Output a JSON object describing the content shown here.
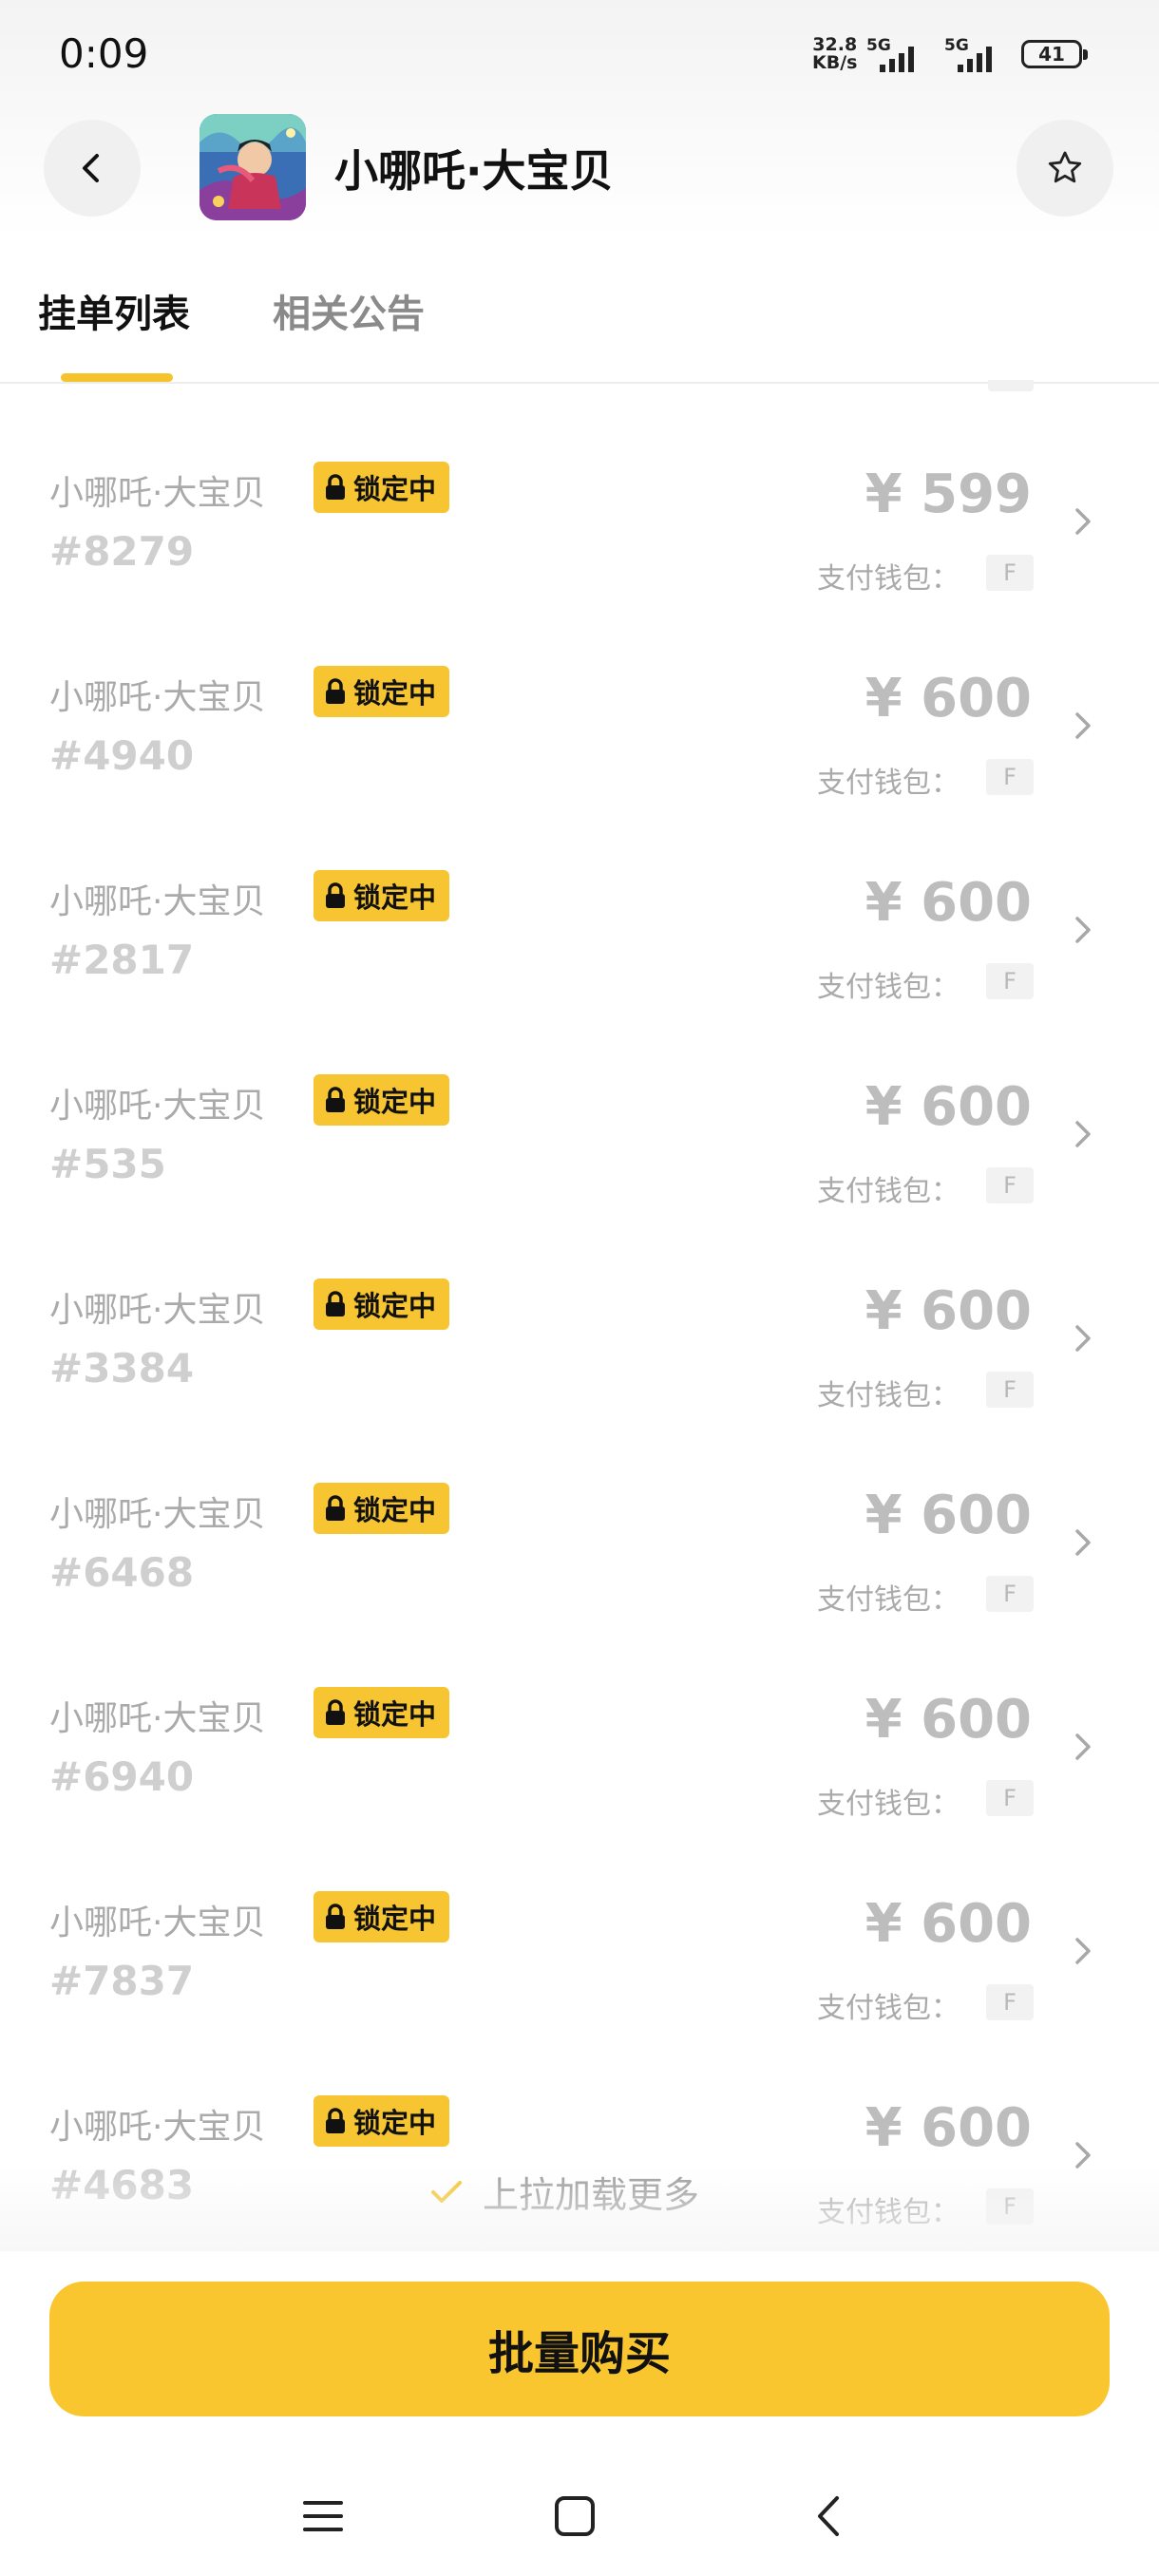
{
  "status_bar": {
    "time": "0:09",
    "net_speed_value": "32.8",
    "net_speed_unit": "KB/s",
    "signal_1_label": "5G",
    "signal_2_label": "5G",
    "battery": "41"
  },
  "header": {
    "title": "小哪吒·大宝贝",
    "back_icon": "chevron-left-icon",
    "favorite_icon": "star-outline-icon"
  },
  "tabs": [
    {
      "label": "挂单列表",
      "active": true
    },
    {
      "label": "相关公告",
      "active": false
    }
  ],
  "listings": [
    {
      "name": "小哪吒·大宝贝",
      "badge": "锁定中",
      "id": "#8279",
      "price": "¥ 599",
      "wallet_label": "支付钱包：",
      "wallet": "F"
    },
    {
      "name": "小哪吒·大宝贝",
      "badge": "锁定中",
      "id": "#4940",
      "price": "¥ 600",
      "wallet_label": "支付钱包：",
      "wallet": "F"
    },
    {
      "name": "小哪吒·大宝贝",
      "badge": "锁定中",
      "id": "#2817",
      "price": "¥ 600",
      "wallet_label": "支付钱包：",
      "wallet": "F"
    },
    {
      "name": "小哪吒·大宝贝",
      "badge": "锁定中",
      "id": "#535",
      "price": "¥ 600",
      "wallet_label": "支付钱包：",
      "wallet": "F"
    },
    {
      "name": "小哪吒·大宝贝",
      "badge": "锁定中",
      "id": "#3384",
      "price": "¥ 600",
      "wallet_label": "支付钱包：",
      "wallet": "F"
    },
    {
      "name": "小哪吒·大宝贝",
      "badge": "锁定中",
      "id": "#6468",
      "price": "¥ 600",
      "wallet_label": "支付钱包：",
      "wallet": "F"
    },
    {
      "name": "小哪吒·大宝贝",
      "badge": "锁定中",
      "id": "#6940",
      "price": "¥ 600",
      "wallet_label": "支付钱包：",
      "wallet": "F"
    },
    {
      "name": "小哪吒·大宝贝",
      "badge": "锁定中",
      "id": "#7837",
      "price": "¥ 600",
      "wallet_label": "支付钱包：",
      "wallet": "F"
    },
    {
      "name": "小哪吒·大宝贝",
      "badge": "锁定中",
      "id": "#4683",
      "price": "¥ 600",
      "wallet_label": "支付钱包：",
      "wallet": "F"
    }
  ],
  "load_more": {
    "text": "上拉加载更多",
    "icon": "check-icon"
  },
  "buy_button": {
    "label": "批量购买"
  },
  "nav_bar": {
    "menu_icon": "menu-icon",
    "home_icon": "home-square-icon",
    "back_icon": "back-triangle-icon"
  },
  "colors": {
    "accent": "#F9C62F",
    "badge_bg": "#F7C531",
    "muted_text": "#AAAAAA",
    "price_text": "#BDBDBD"
  }
}
